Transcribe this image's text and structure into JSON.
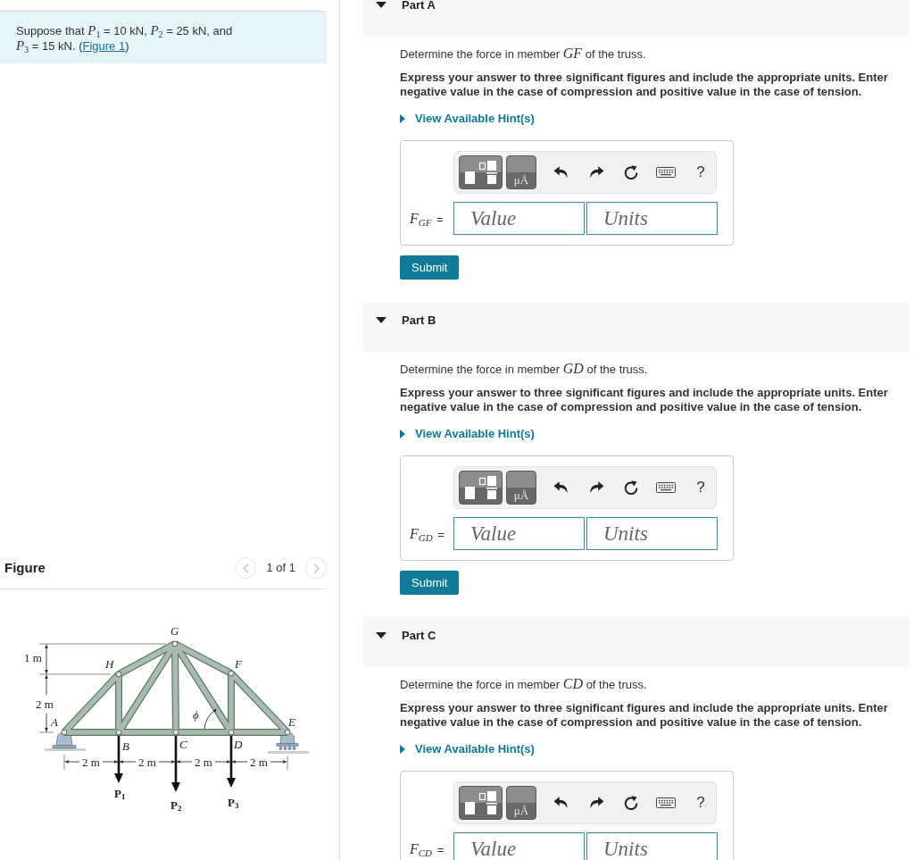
{
  "problem": {
    "text": "Suppose that *P*$_{1}$ = 10 kN, *P*$_{2}$ = 25 kN, and *P*$_{3}$ = 15 kN. (",
    "link": "Figure 1",
    "text_end": ")"
  },
  "figure": {
    "title": "Figure",
    "prev": {
      "disabled": true
    },
    "pager": "1 of 1",
    "next": {
      "disabled": true
    },
    "joints": [
      "G",
      "H",
      "F",
      "A",
      "E",
      "B",
      "C",
      "D"
    ],
    "heights": [
      "1 m",
      "2 m"
    ],
    "spans": [
      "2 m",
      "2 m",
      "2 m",
      "2 m"
    ],
    "loads": [
      "P$_{1}$",
      "P$_{2}$",
      "P$_{3}$"
    ],
    "angle": "ϕ"
  },
  "parts": [
    {
      "title": "Part A",
      "expanded": true,
      "question": "Determine the force in member *GF* of the truss.",
      "instructions": "Express your answer to three significant figures and include the appropriate units. Enter negative value in the case of compression and positive value in the case of tension.",
      "hint": {
        "label": "View Available Hint(s)",
        "expanded": false
      },
      "toolbar": {
        "units_button": "μÅ",
        "help_button": "?"
      },
      "answer": {
        "label": "*F*$_{GF}$ =",
        "value_placeholder": "Value",
        "units_placeholder": "Units"
      },
      "submit": "Submit"
    },
    {
      "title": "Part B",
      "expanded": true,
      "question": "Determine the force in member *GD* of the truss.",
      "instructions": "Express your answer to three significant figures and include the appropriate units. Enter negative value in the case of compression and positive value in the case of tension.",
      "hint": {
        "label": "View Available Hint(s)",
        "expanded": false
      },
      "toolbar": {
        "units_button": "μÅ",
        "help_button": "?"
      },
      "answer": {
        "label": "*F*$_{GD}$ =",
        "value_placeholder": "Value",
        "units_placeholder": "Units"
      },
      "submit": "Submit"
    },
    {
      "title": "Part C",
      "expanded": true,
      "question": "Determine the force in member *CD* of the truss.",
      "instructions": "Express your answer to three significant figures and include the appropriate units. Enter negative value in the case of compression and positive value in the case of tension.",
      "hint": {
        "label": "View Available Hint(s)",
        "expanded": false
      },
      "toolbar": {
        "units_button": "μÅ",
        "help_button": "?"
      },
      "answer": {
        "label": "*F*$_{CD}$ =",
        "value_placeholder": "Value",
        "units_placeholder": "Units"
      }
    }
  ]
}
